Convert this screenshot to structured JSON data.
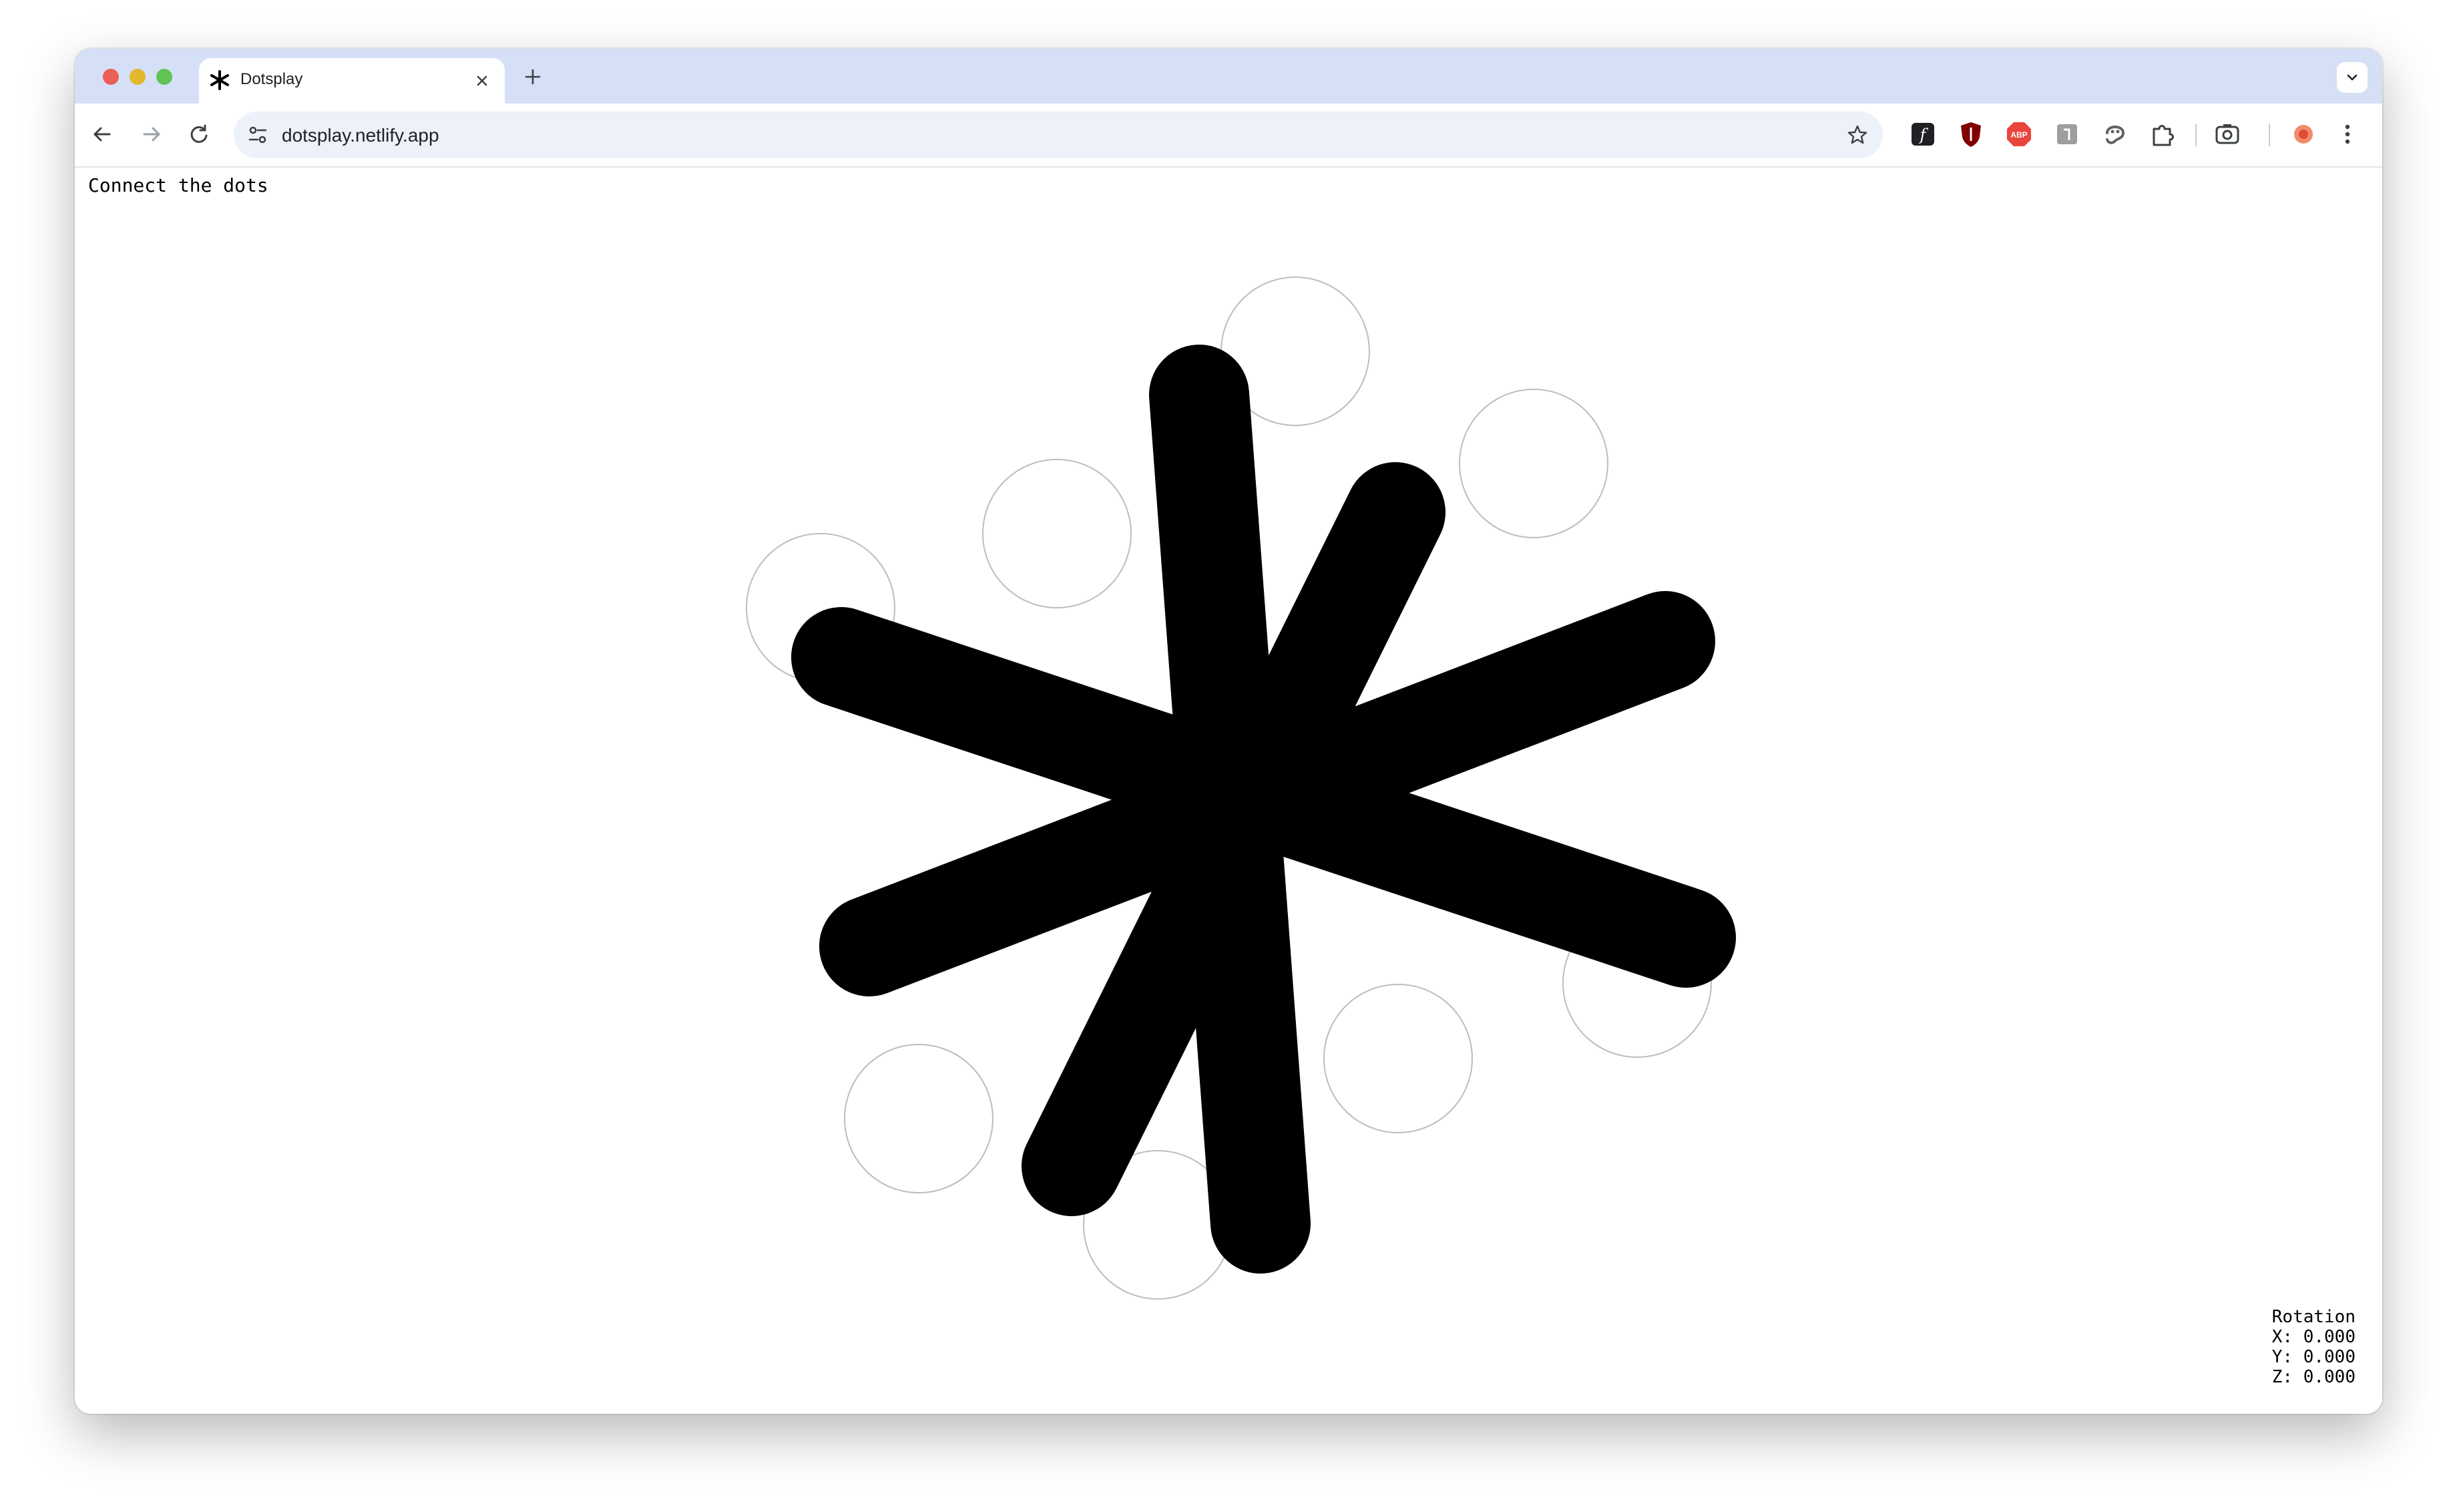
{
  "browser": {
    "tab_title": "Dotsplay",
    "url": "dotsplay.netlify.app",
    "tab_icon": "asterisk-icon",
    "extensions": [
      "font-icon",
      "shield-icon",
      "abp-icon",
      "square-extension-icon",
      "face-extension-icon",
      "puzzle-icon",
      "camera-icon",
      "profile-avatar-icon",
      "more-icon"
    ]
  },
  "page": {
    "heading": "Connect the dots",
    "rotation": {
      "title": "Rotation",
      "x": "X: 0.000",
      "y": "Y: 0.000",
      "z": "Z: 0.000"
    }
  },
  "colors": {
    "tabbar": "#d5e0f7",
    "omnibox": "#edf1fa",
    "stroke": "#000000",
    "dot_outline": "#bdbdbd"
  }
}
